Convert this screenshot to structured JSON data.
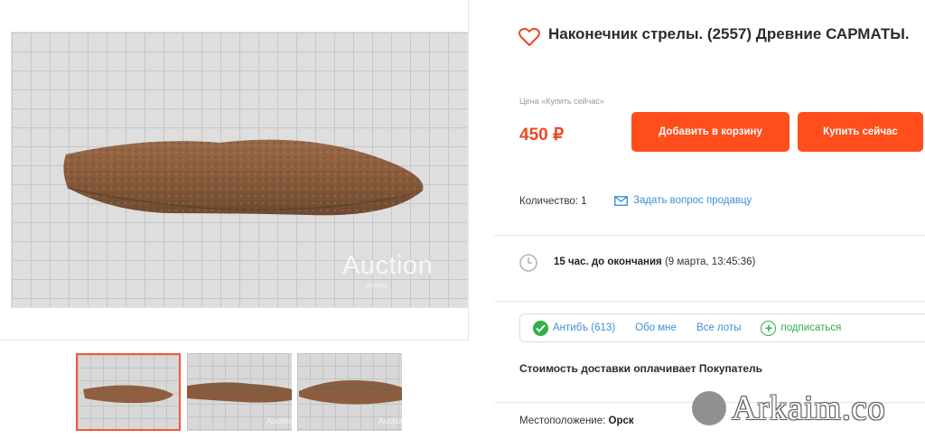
{
  "gallery": {
    "main_watermark": "Auction",
    "main_watermark_sub": "Антибъ",
    "thumb_watermark": "Auction",
    "thumbnail_count": 3,
    "active_thumbnail": 1
  },
  "product": {
    "title": "Наконечник стрелы. (2557) Древние САРМАТЫ.",
    "price_label": "Цена «Купить сейчас»",
    "price": "450 ₽",
    "add_to_cart_label": "Добавить в корзину",
    "buy_now_label": "Купить сейчас",
    "quantity_text": "Количество: 1",
    "ask_seller_label": "Задать вопрос продавцу"
  },
  "timer": {
    "remaining": "15 час. до окончания",
    "end_time": "(9 марта, 13:45:36)"
  },
  "seller": {
    "name_rating": "Антибъ (613)",
    "about_label": "Обо мне",
    "all_lots_label": "Все лоты",
    "subscribe_label": "подписаться"
  },
  "delivery_text": "Стоимость доставки оплачивает Покупатель",
  "location": {
    "label": "Местоположение:",
    "value": "Орск"
  },
  "site_watermark": "Arkaim.co",
  "colors": {
    "accent": "#ff4d1c",
    "price": "#ee4a1e",
    "link": "#3f8fd8",
    "verified": "#2fb04a"
  },
  "icons": [
    "heart-icon",
    "envelope-icon",
    "clock-icon",
    "check-icon",
    "plus-icon"
  ]
}
